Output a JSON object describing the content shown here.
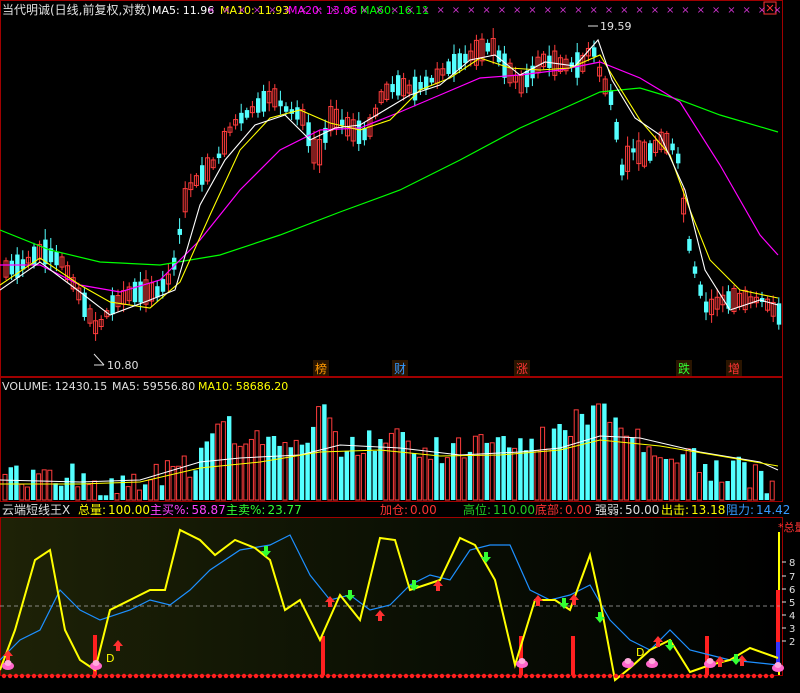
{
  "price_header": {
    "title": "当代明诚(日线,前复权,对数)",
    "ma5_label": "MA5:",
    "ma5": "11.96",
    "ma10_label": "MA10:",
    "ma10": "11.93",
    "ma20_label": "MA20:",
    "ma20": "13.06",
    "ma60_label": "MA60:",
    "ma60": "16.11"
  },
  "price_marks": {
    "high": "19.59",
    "low": "10.80"
  },
  "event_markers": [
    {
      "text": "榜",
      "color": "#ff9900"
    },
    {
      "text": "财",
      "color": "#3399ff"
    },
    {
      "text": "涨",
      "color": "#ff3333"
    },
    {
      "text": "跌",
      "color": "#33ff33"
    },
    {
      "text": "增",
      "color": "#ff3333"
    }
  ],
  "volume_header": {
    "label": "VOLUME:",
    "value": "12430.15",
    "ma5_label": "MA5:",
    "ma5": "59556.80",
    "ma10_label": "MA10:",
    "ma10": "58686.20"
  },
  "indicator_header": {
    "name": "云端短线王X",
    "total_label": "总量:",
    "total": "100.00",
    "buy_label": "主买%:",
    "buy": "58.87",
    "sell_label": "主卖%:",
    "sell": "23.77",
    "add_label": "加仓:",
    "add": "0.00",
    "high_label": "高位:",
    "high": "110.00",
    "bottom_label": "底部:",
    "bottom": "0.00",
    "strength_label": "强弱:",
    "strength": "50.00",
    "exit_label": "出击:",
    "exit": "13.18",
    "resist_label": "阻力:",
    "resist": "14.42"
  },
  "indicator_axis": {
    "corner": "*总量",
    "ticks": [
      "8",
      "7",
      "6",
      "5",
      "4",
      "3",
      "2"
    ]
  },
  "signal_label": "D",
  "colors": {
    "up": "#ff3c3c",
    "down": "#54ffff",
    "ma5": "#ffffff",
    "ma10": "#ffff00",
    "ma20": "#ff00ff",
    "ma60": "#00ff00",
    "grid": "#a00000"
  }
}
